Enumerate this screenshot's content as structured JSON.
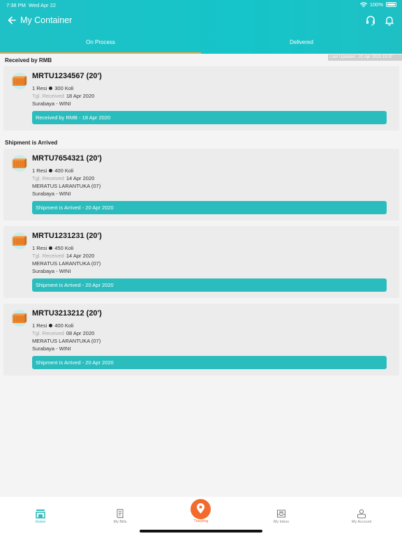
{
  "status": {
    "time": "7:38 PM",
    "date": "Wed Apr 22",
    "battery": "100%"
  },
  "header": {
    "title": "My Container"
  },
  "tabs": [
    {
      "label": "On Process"
    },
    {
      "label": "Delivered"
    }
  ],
  "last_updated": "Last Updated : 22 Apr 2020 19:37",
  "sections": [
    {
      "title": "Received by RMB"
    },
    {
      "title": "Shipment is Arrived"
    }
  ],
  "cards": [
    {
      "name": "MRTU1234567 (20')",
      "resi": "1 Resi",
      "koli": "300 Koli",
      "tgl_label": "Tgl. Received",
      "tgl": "18 Apr 2020",
      "vessel": "",
      "route": "Surabaya - WINI",
      "status": "Received by RMB - 18 Apr 2020"
    },
    {
      "name": "MRTU7654321 (20')",
      "resi": "1 Resi",
      "koli": "400 Koli",
      "tgl_label": "Tgl. Received",
      "tgl": "14 Apr 2020",
      "vessel": "MERATUS LARANTUKA (07)",
      "route": "Surabaya - WINI",
      "status": "Shipment is Arrived - 20 Apr 2020"
    },
    {
      "name": "MRTU1231231 (20')",
      "resi": "1 Resi",
      "koli": "450 Koli",
      "tgl_label": "Tgl. Received",
      "tgl": "14 Apr 2020",
      "vessel": "MERATUS LARANTUKA (07)",
      "route": "Surabaya - WINI",
      "status": "Shipment is Arrived - 20 Apr 2020"
    },
    {
      "name": "MRTU3213212 (20')",
      "resi": "1 Resi",
      "koli": "400 Koli",
      "tgl_label": "Tgl. Received",
      "tgl": "08 Apr 2020",
      "vessel": "MERATUS LARANTUKA (07)",
      "route": "Surabaya - WINI",
      "status": "Shipment is Arrived - 20 Apr 2020"
    }
  ],
  "nav": {
    "home": "Home",
    "bills": "My Bills",
    "tracking": "Tracking",
    "inbox": "My Inbox",
    "account": "My Account"
  },
  "colors": {
    "primary": "#2bbcbd",
    "accent": "#f26b2d",
    "tab_indicator": "#f7a23b"
  },
  "icons": [
    "back-arrow-icon",
    "headset-icon",
    "bell-icon",
    "container-icon",
    "home-icon",
    "bill-icon",
    "location-pin-icon",
    "inbox-icon",
    "account-icon"
  ]
}
